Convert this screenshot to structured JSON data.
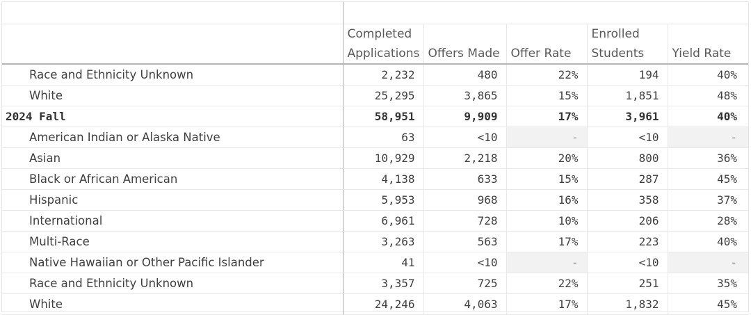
{
  "columns": {
    "apps": [
      "Completed",
      "Applications"
    ],
    "offers": [
      "",
      "Offers Made"
    ],
    "rate": [
      "",
      "Offer Rate"
    ],
    "enrolled": [
      "Enrolled",
      "Students"
    ],
    "yield": [
      "",
      "Yield Rate"
    ]
  },
  "rows": [
    {
      "label": "Race and Ethnicity Unknown",
      "apps": "2,232",
      "offers": "480",
      "rate": "22%",
      "enrolled": "194",
      "yield": "40%",
      "group": false,
      "rate_muted": false,
      "yield_muted": false
    },
    {
      "label": "White",
      "apps": "25,295",
      "offers": "3,865",
      "rate": "15%",
      "enrolled": "1,851",
      "yield": "48%",
      "group": false,
      "rate_muted": false,
      "yield_muted": false
    },
    {
      "label": "2024 Fall",
      "apps": "58,951",
      "offers": "9,909",
      "rate": "17%",
      "enrolled": "3,961",
      "yield": "40%",
      "group": true,
      "rate_muted": false,
      "yield_muted": false
    },
    {
      "label": "American Indian or Alaska Native",
      "apps": "63",
      "offers": "<10",
      "rate": "-",
      "enrolled": "<10",
      "yield": "-",
      "group": false,
      "rate_muted": true,
      "yield_muted": true
    },
    {
      "label": "Asian",
      "apps": "10,929",
      "offers": "2,218",
      "rate": "20%",
      "enrolled": "800",
      "yield": "36%",
      "group": false,
      "rate_muted": false,
      "yield_muted": false
    },
    {
      "label": "Black or African American",
      "apps": "4,138",
      "offers": "633",
      "rate": "15%",
      "enrolled": "287",
      "yield": "45%",
      "group": false,
      "rate_muted": false,
      "yield_muted": false
    },
    {
      "label": "Hispanic",
      "apps": "5,953",
      "offers": "968",
      "rate": "16%",
      "enrolled": "358",
      "yield": "37%",
      "group": false,
      "rate_muted": false,
      "yield_muted": false
    },
    {
      "label": "International",
      "apps": "6,961",
      "offers": "728",
      "rate": "10%",
      "enrolled": "206",
      "yield": "28%",
      "group": false,
      "rate_muted": false,
      "yield_muted": false
    },
    {
      "label": "Multi-Race",
      "apps": "3,263",
      "offers": "563",
      "rate": "17%",
      "enrolled": "223",
      "yield": "40%",
      "group": false,
      "rate_muted": false,
      "yield_muted": false
    },
    {
      "label": "Native Hawaiian or Other Pacific Islander",
      "apps": "41",
      "offers": "<10",
      "rate": "-",
      "enrolled": "<10",
      "yield": "-",
      "group": false,
      "rate_muted": true,
      "yield_muted": true
    },
    {
      "label": "Race and Ethnicity Unknown",
      "apps": "3,357",
      "offers": "725",
      "rate": "22%",
      "enrolled": "251",
      "yield": "35%",
      "group": false,
      "rate_muted": false,
      "yield_muted": false
    },
    {
      "label": "White",
      "apps": "24,246",
      "offers": "4,063",
      "rate": "17%",
      "enrolled": "1,832",
      "yield": "45%",
      "group": false,
      "rate_muted": false,
      "yield_muted": false
    }
  ],
  "colors": {
    "text": "#404040",
    "header_text": "#595959",
    "muted_cell_bg": "#f2f2f2",
    "grid_line": "#e8e8e8",
    "divider": "#b0b0b0"
  }
}
